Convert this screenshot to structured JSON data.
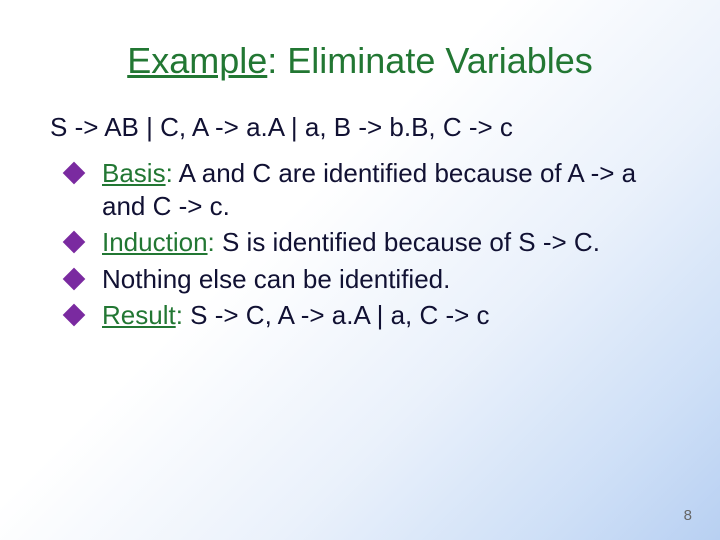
{
  "title": {
    "underlined": "Example",
    "rest": ": Eliminate Variables"
  },
  "grammar": "S -> AB | C, A -> a.A | a, B -> b.B, C -> c",
  "bullets": [
    {
      "lead_ul": "Basis",
      "lead_rest": ":",
      "text": " A and C are identified because of A -> a and C -> c."
    },
    {
      "lead_ul": "Induction",
      "lead_rest": ":",
      "text": " S is identified because of S -> C."
    },
    {
      "lead_ul": "",
      "lead_rest": "",
      "text": "Nothing else can be identified."
    },
    {
      "lead_ul": "Result",
      "lead_rest": ":",
      "text": " S -> C, A -> a.A | a, C -> c"
    }
  ],
  "pagenum": "8"
}
